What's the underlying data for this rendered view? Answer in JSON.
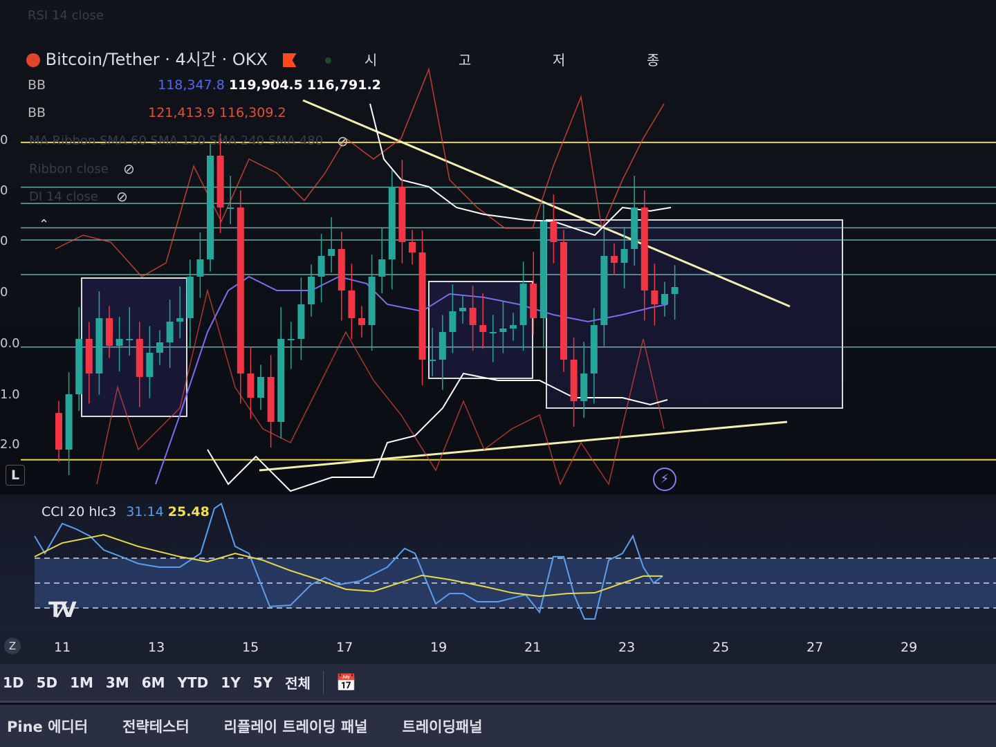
{
  "header": {
    "faded_indicator": "RSI 14 close",
    "symbol": "Bitcoin/Tether · 4시간 · OKX",
    "ohlc_labels": [
      "시",
      "고",
      "저",
      "종"
    ]
  },
  "bb1": {
    "label": "BB",
    "values": [
      "118,347.8",
      "119,904.5",
      "116,791.2"
    ]
  },
  "bb2": {
    "label": "BB",
    "values": [
      "121,413.9",
      "116,309.2"
    ]
  },
  "faded_lines": [
    "MA Ribbon SMA 60 SMA 120 SMA 240 SMA 480",
    "Ribbon close",
    "DI 14 close"
  ],
  "left_axis_labels": [
    "0",
    "0",
    "0",
    "0",
    "0.0",
    "1.0",
    "2.0"
  ],
  "l_button": "L",
  "colors": {
    "up": "#26a69a",
    "down": "#f23645",
    "bb_mid": "#7b6cf0",
    "cci": "#5aa0f0",
    "cci_ma": "#e8d84a",
    "level": "#e6d84a",
    "hline": "#7fd3c8"
  },
  "chart_data": [
    {
      "type": "candlestick",
      "title": "Bitcoin/Tether 4H OKX",
      "ylim": [
        113000,
        122000
      ],
      "closes": [
        113850,
        115210,
        116570,
        115720,
        117080,
        116400,
        116570,
        116570,
        115635,
        116230,
        116485,
        116995,
        117080,
        118100,
        118525,
        121075,
        119800,
        119800,
        115720,
        115125,
        115635,
        114530,
        116570,
        116570,
        117420,
        118100,
        118610,
        118780,
        117760,
        117080,
        116910,
        118100,
        118525,
        120310,
        118950,
        118695,
        116060,
        116060,
        116740,
        117250,
        117335,
        116910,
        116740,
        116740,
        116825,
        116910,
        117930,
        117080,
        119460,
        118950,
        116060,
        115040,
        115720,
        116910,
        118610,
        118440,
        118780,
        119800,
        117760,
        117420,
        117675,
        117845
      ],
      "levels": [
        121400,
        113600
      ],
      "hlines": [
        120300,
        119900,
        119300,
        119000,
        118150,
        116370
      ],
      "x_ticks": [
        "11",
        "13",
        "15",
        "17",
        "19",
        "21",
        "23",
        "25",
        "27",
        "29"
      ]
    },
    {
      "type": "line",
      "title": "CCI 20 hlc3",
      "legend": [
        "31.14",
        "25.48"
      ],
      "ylim": [
        -180,
        340
      ],
      "levels": [
        100,
        0,
        -100
      ],
      "series": [
        {
          "name": "CCI",
          "points": [
            [
              0,
              189
            ],
            [
              0.15,
              119
            ],
            [
              0.4,
              239
            ],
            [
              0.6,
              217
            ],
            [
              0.8,
              189
            ],
            [
              1,
              133
            ],
            [
              1.25,
              106
            ],
            [
              1.5,
              78
            ],
            [
              1.8,
              64
            ],
            [
              2.1,
              64
            ],
            [
              2.4,
              119
            ],
            [
              2.6,
              300
            ],
            [
              2.7,
              319
            ],
            [
              2.9,
              147
            ],
            [
              3.1,
              119
            ],
            [
              3.4,
              -94
            ],
            [
              3.7,
              -89
            ],
            [
              4,
              -6
            ],
            [
              4.2,
              22
            ],
            [
              4.4,
              -6
            ],
            [
              4.7,
              8
            ],
            [
              5.1,
              64
            ],
            [
              5.35,
              139
            ],
            [
              5.5,
              119
            ],
            [
              5.8,
              -83
            ],
            [
              6,
              -42
            ],
            [
              6.2,
              -42
            ],
            [
              6.4,
              -75
            ],
            [
              6.7,
              -75
            ],
            [
              7.1,
              -47
            ],
            [
              7.3,
              -117
            ],
            [
              7.5,
              106
            ],
            [
              7.65,
              106
            ],
            [
              7.8,
              -47
            ],
            [
              7.95,
              -144
            ],
            [
              8.1,
              -144
            ],
            [
              8.3,
              92
            ],
            [
              8.5,
              119
            ],
            [
              8.65,
              189
            ],
            [
              8.8,
              64
            ],
            [
              8.95,
              0
            ],
            [
              9.08,
              28
            ]
          ]
        },
        {
          "name": "CCI MA",
          "points": [
            [
              0,
              106
            ],
            [
              0.4,
              161
            ],
            [
              1,
              194
            ],
            [
              1.5,
              147
            ],
            [
              2.1,
              106
            ],
            [
              2.5,
              86
            ],
            [
              2.9,
              119
            ],
            [
              3.3,
              92
            ],
            [
              3.7,
              50
            ],
            [
              4.1,
              14
            ],
            [
              4.5,
              -25
            ],
            [
              4.9,
              -33
            ],
            [
              5.3,
              3
            ],
            [
              5.6,
              31
            ],
            [
              6,
              14
            ],
            [
              6.5,
              -14
            ],
            [
              6.9,
              -39
            ],
            [
              7.3,
              -53
            ],
            [
              7.7,
              -42
            ],
            [
              8.1,
              -39
            ],
            [
              8.5,
              0
            ],
            [
              8.8,
              28
            ],
            [
              9.08,
              28
            ]
          ]
        }
      ]
    }
  ],
  "range_buttons": [
    "1D",
    "5D",
    "1M",
    "3M",
    "6M",
    "YTD",
    "1Y",
    "5Y",
    "전체"
  ],
  "bottom_tabs": [
    "Pine 에디터",
    "전략테스터",
    "리플레이 트레이딩 패널",
    "트레이딩패널"
  ],
  "zoom_label": "Z"
}
